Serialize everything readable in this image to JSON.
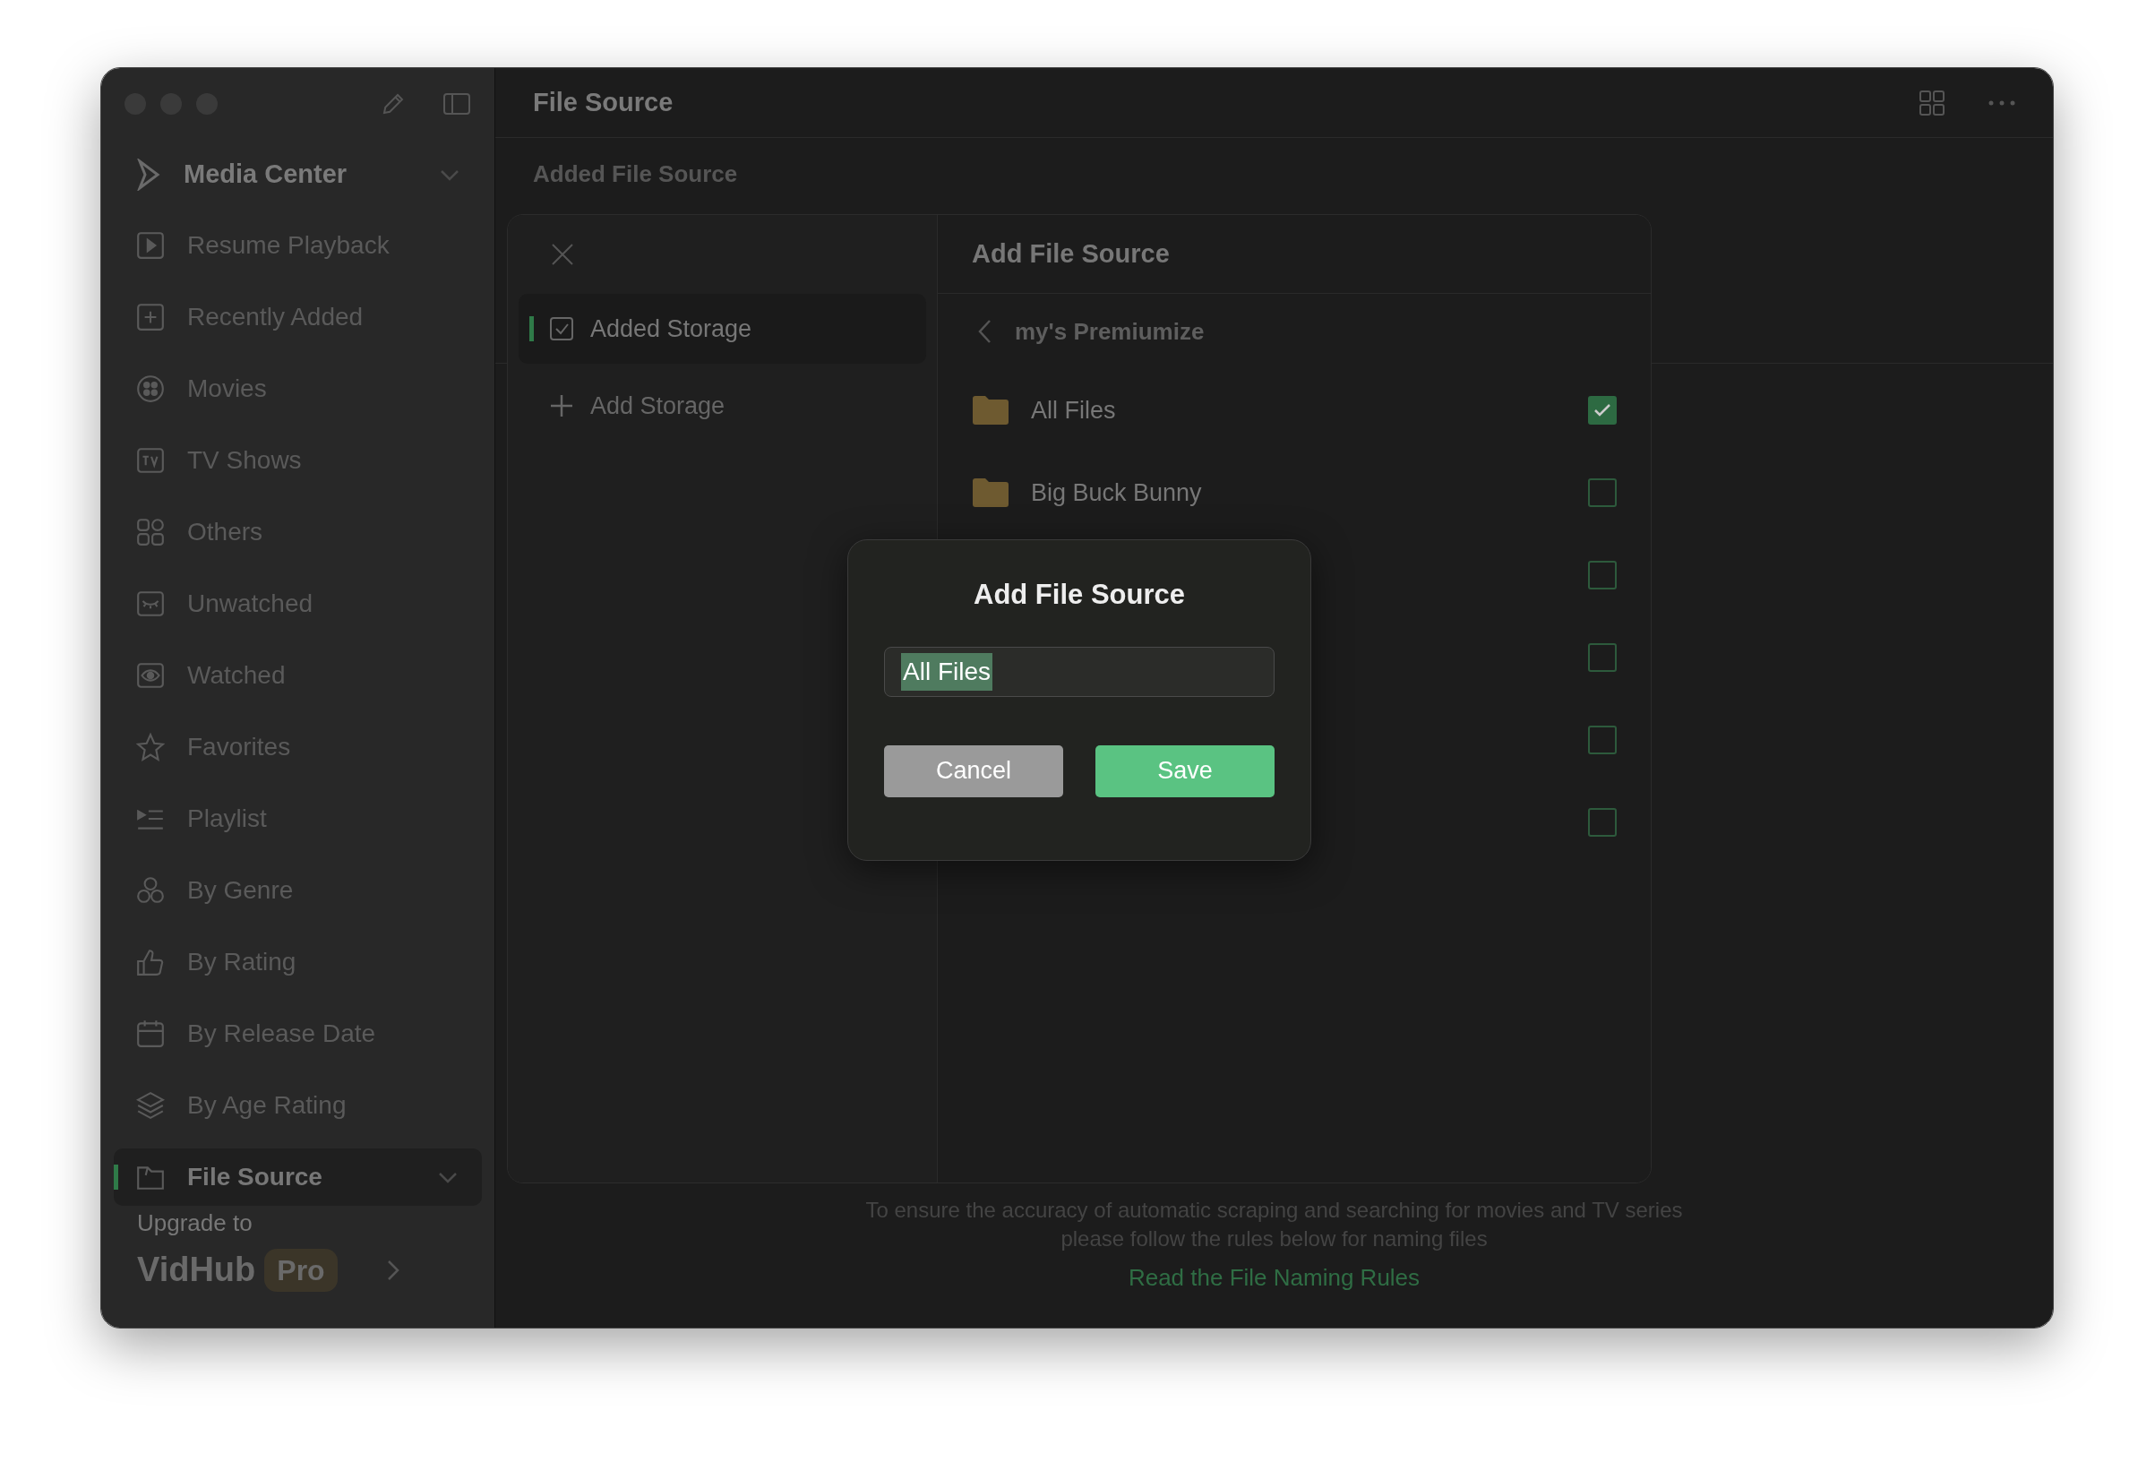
{
  "window": {
    "title": "File Source"
  },
  "sidebar": {
    "section": {
      "label": "Media Center",
      "expanded": true
    },
    "items": [
      {
        "label": "Resume Playback",
        "selected": false
      },
      {
        "label": "Recently Added",
        "selected": false
      },
      {
        "label": "Movies",
        "selected": false
      },
      {
        "label": "TV Shows",
        "selected": false
      },
      {
        "label": "Others",
        "selected": false
      },
      {
        "label": "Unwatched",
        "selected": false
      },
      {
        "label": "Watched",
        "selected": false
      },
      {
        "label": "Favorites",
        "selected": false
      },
      {
        "label": "Playlist",
        "selected": false
      },
      {
        "label": "By Genre",
        "selected": false
      },
      {
        "label": "By Rating",
        "selected": false
      },
      {
        "label": "By Release Date",
        "selected": false
      },
      {
        "label": "By Age Rating",
        "selected": false
      },
      {
        "label": "File Source",
        "selected": true
      }
    ],
    "upgrade": {
      "caption": "Upgrade to",
      "product": "VidHub",
      "badge": "Pro"
    }
  },
  "main": {
    "subtitle": "Added File Source",
    "footer": {
      "note": "To ensure the accuracy of automatic scraping and searching for movies and TV series\nplease follow the rules below for naming files",
      "link": "Read the File Naming Rules"
    }
  },
  "panel": {
    "nav": [
      {
        "label": "Added Storage",
        "selected": true
      },
      {
        "label": "Add Storage",
        "selected": false
      }
    ],
    "title": "Add File Source",
    "path": "my's Premiumize",
    "rows": [
      {
        "name": "All Files",
        "checked": true
      },
      {
        "name": "Big Buck Bunny",
        "checked": false
      },
      {
        "checked": false
      },
      {
        "checked": false
      },
      {
        "checked": false
      },
      {
        "checked": false
      }
    ]
  },
  "dialog": {
    "title": "Add File Source",
    "value": "All Files",
    "buttons": [
      {
        "label": "Cancel",
        "kind": "secondary"
      },
      {
        "label": "Save",
        "kind": "primary"
      }
    ]
  }
}
